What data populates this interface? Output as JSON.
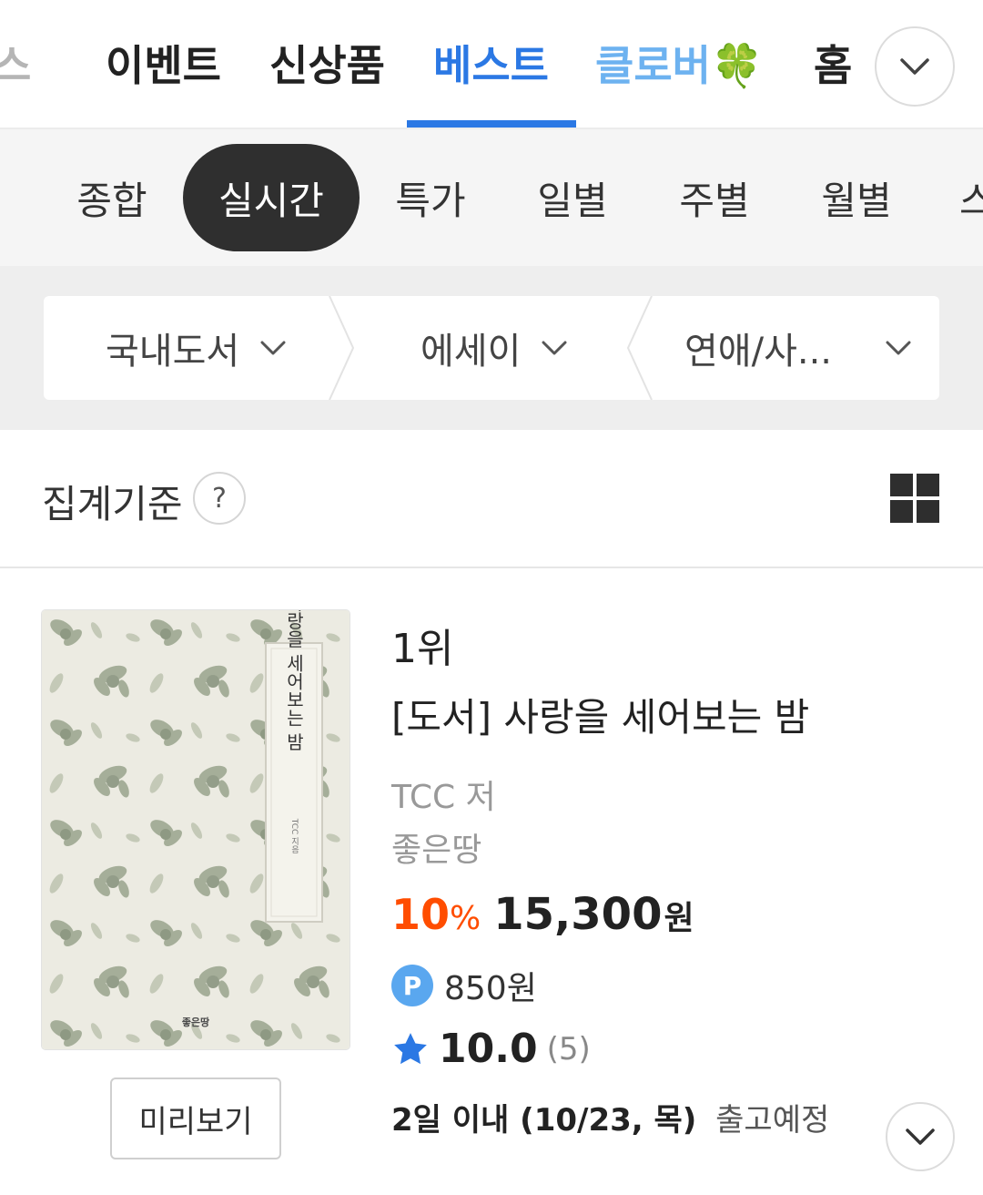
{
  "top_tabs": [
    {
      "label": "스",
      "state": "faded"
    },
    {
      "label": "이벤트",
      "state": "normal"
    },
    {
      "label": "신상품",
      "state": "normal"
    },
    {
      "label": "베스트",
      "state": "active"
    },
    {
      "label": "클로버🍀",
      "state": "highlight"
    },
    {
      "label": "홈",
      "state": "normal"
    }
  ],
  "period_tabs": [
    "종합",
    "실시간",
    "특가",
    "일별",
    "주별",
    "월별",
    "스"
  ],
  "period_active": "실시간",
  "categories": [
    {
      "label": "국내도서"
    },
    {
      "label": "에세이"
    },
    {
      "label": "연애/사..."
    }
  ],
  "criteria": {
    "label": "집계기준",
    "help": "?"
  },
  "product": {
    "rank": "1위",
    "title": "[도서] 사랑을 세어보는 밤",
    "author": "TCC 저",
    "publisher": "좋은땅",
    "discount": "10",
    "discount_sign": "%",
    "price": "15,300",
    "price_unit": "원",
    "point_badge": "P",
    "points": "850원",
    "rating": "10.0",
    "review_count": "(5)",
    "shipping_bold": "2일 이내 (10/23, 목)",
    "shipping_text": "출고예정",
    "preview_label": "미리보기",
    "cover": {
      "title": "사랑을 세어보는 밤",
      "author": "TCC 지음",
      "publisher_mark": "좋은땅"
    }
  },
  "colors": {
    "accent": "#2b78e4",
    "discount": "#ff4d00",
    "star": "#2b78e4",
    "point": "#5aa7ef"
  }
}
